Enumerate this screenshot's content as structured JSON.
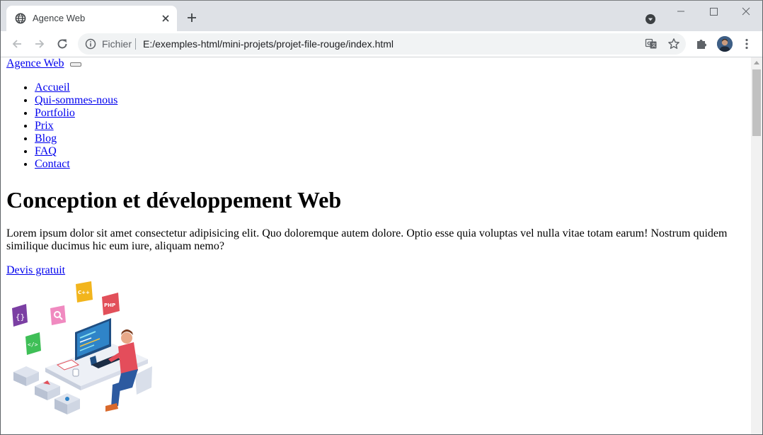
{
  "browser": {
    "tab": {
      "title": "Agence Web",
      "icon": "globe-icon"
    },
    "address": {
      "scheme_label": "Fichier",
      "url": "E:/exemples-html/mini-projets/projet-file-rouge/index.html"
    },
    "colors": {
      "tabstrip": "#dee1e6",
      "omnibox": "#f1f3f4",
      "link": "#0000ee"
    }
  },
  "page": {
    "brand": "Agence Web",
    "nav": [
      "Accueil",
      "Qui-sommes-nous",
      "Portfolio",
      "Prix",
      "Blog",
      "FAQ",
      "Contact"
    ],
    "hero": {
      "title": "Conception et développement Web",
      "text": "Lorem ipsum dolor sit amet consectetur adipisicing elit. Quo doloremque autem dolore. Optio esse quia voluptas vel nulla vitae totam earum! Nostrum quidem similique ducimus hic eum iure, aliquam nemo?",
      "cta": "Devis gratuit",
      "illustration_labels": [
        "{}",
        "</>",
        "C++",
        "PHP"
      ]
    }
  }
}
